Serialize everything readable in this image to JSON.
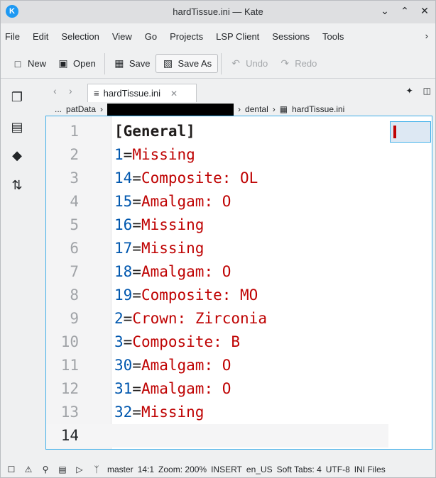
{
  "window": {
    "title": "hardTissue.ini — Kate"
  },
  "menu": [
    "File",
    "Edit",
    "Selection",
    "View",
    "Go",
    "Projects",
    "LSP Client",
    "Sessions",
    "Tools"
  ],
  "toolbar": {
    "new": "New",
    "open": "Open",
    "save": "Save",
    "save_as": "Save As",
    "undo": "Undo",
    "redo": "Redo"
  },
  "tab": {
    "label": "hardTissue.ini"
  },
  "breadcrumb": {
    "ellipsis": "...",
    "item1": "patData",
    "item3": "dental",
    "item4": "hardTissue.ini"
  },
  "editor": {
    "lines": [
      {
        "num": "1",
        "section": "[General]"
      },
      {
        "num": "2",
        "key": "1",
        "value": "Missing"
      },
      {
        "num": "3",
        "key": "14",
        "value": "Composite: OL"
      },
      {
        "num": "4",
        "key": "15",
        "value": "Amalgam: O"
      },
      {
        "num": "5",
        "key": "16",
        "value": "Missing"
      },
      {
        "num": "6",
        "key": "17",
        "value": "Missing"
      },
      {
        "num": "7",
        "key": "18",
        "value": "Amalgam: O"
      },
      {
        "num": "8",
        "key": "19",
        "value": "Composite: MO"
      },
      {
        "num": "9",
        "key": "2",
        "value": "Crown: Zirconia"
      },
      {
        "num": "10",
        "key": "3",
        "value": "Composite: B"
      },
      {
        "num": "11",
        "key": "30",
        "value": "Amalgam: O"
      },
      {
        "num": "12",
        "key": "31",
        "value": "Amalgam: O"
      },
      {
        "num": "13",
        "key": "32",
        "value": "Missing"
      },
      {
        "num": "14",
        "key": "",
        "value": ""
      }
    ]
  },
  "statusbar": {
    "branch": "master",
    "position": "14:1",
    "zoom": "Zoom: 200%",
    "mode": "INSERT",
    "dictionary": "en_US",
    "indent": "Soft Tabs: 4",
    "encoding": "UTF-8",
    "filetype": "INI Files"
  }
}
